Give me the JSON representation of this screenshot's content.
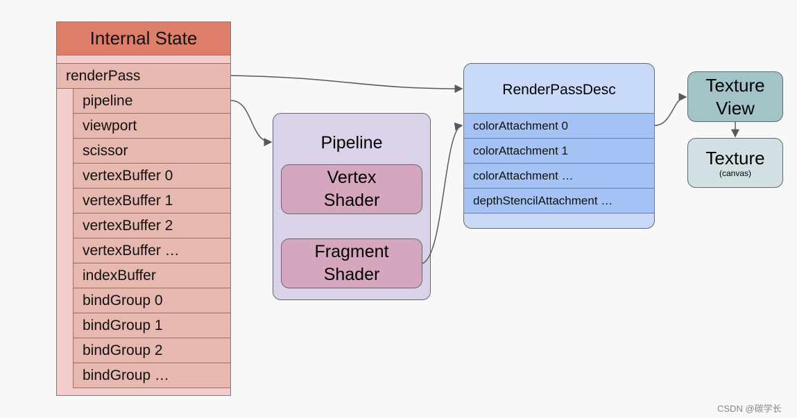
{
  "internal_state": {
    "title": "Internal State",
    "render_pass": "renderPass",
    "items": [
      "pipeline",
      "viewport",
      "scissor",
      "vertexBuffer 0",
      "vertexBuffer 1",
      "vertexBuffer 2",
      "vertexBuffer …",
      "indexBuffer",
      "bindGroup 0",
      "bindGroup 1",
      "bindGroup 2",
      "bindGroup …"
    ]
  },
  "pipeline": {
    "title": "Pipeline",
    "vertex_line1": "Vertex",
    "vertex_line2": "Shader",
    "fragment_line1": "Fragment",
    "fragment_line2": "Shader"
  },
  "render_pass_desc": {
    "title": "RenderPassDesc",
    "items": [
      "colorAttachment 0",
      "colorAttachment 1",
      "colorAttachment …",
      "depthStencilAttachment …"
    ]
  },
  "texture_view": {
    "line1": "Texture",
    "line2": "View"
  },
  "texture": {
    "title": "Texture",
    "subtitle": "(canvas)"
  },
  "watermark": "CSDN @碳学长",
  "colors": {
    "state_header": "#dd7e6b",
    "state_row": "#e6b8af",
    "state_bg": "#f4cccc",
    "pipeline_bg": "#d9d2e9",
    "shader": "#d5a6bd",
    "rpd_bg": "#c9daf8",
    "rpd_row": "#a4c2f4",
    "texture_view": "#a2c4c9",
    "texture": "#d0e0e3"
  }
}
